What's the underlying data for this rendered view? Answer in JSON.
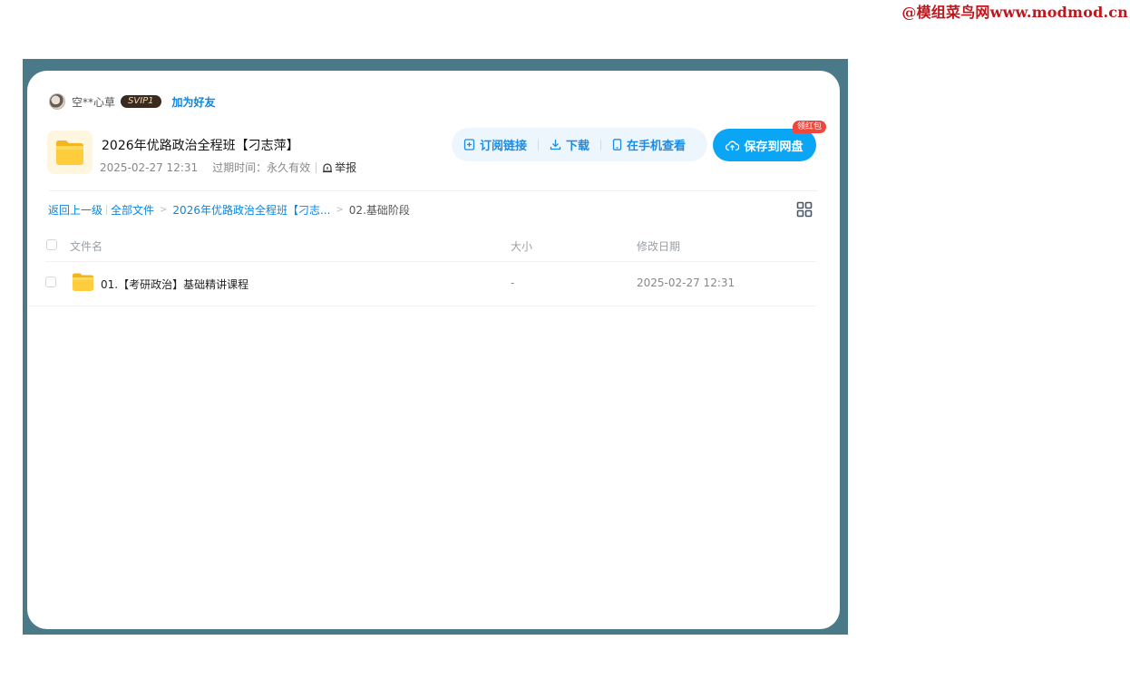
{
  "watermark": "@模组菜鸟网www.modmod.cn",
  "sharer": {
    "name": "空**心草",
    "badge": "SVIP1",
    "add_friend": "加为好友"
  },
  "share": {
    "title": "2026年优路政治全程班【刁志萍】",
    "date": "2025-02-27 12:31",
    "expire": "过期时间：永久有效",
    "report": "举报"
  },
  "actions": {
    "subscribe": "订阅链接",
    "download": "下载",
    "mobile": "在手机查看",
    "save": "保存到网盘",
    "hongbao": "领红包"
  },
  "breadcrumb": {
    "back": "返回上一级",
    "all_files": "全部文件",
    "parent": "2026年优路政治全程班【刁志...",
    "current": "02.基础阶段"
  },
  "table": {
    "headers": {
      "name": "文件名",
      "size": "大小",
      "date": "修改日期"
    },
    "rows": [
      {
        "name": "01.【考研政治】基础精讲课程",
        "size": "-",
        "date": "2025-02-27 12:31"
      }
    ]
  },
  "colors": {
    "accent": "#0aa5f5",
    "link": "#0a86e0",
    "frame": "#4a7a88",
    "badge_red": "#f0473d"
  }
}
